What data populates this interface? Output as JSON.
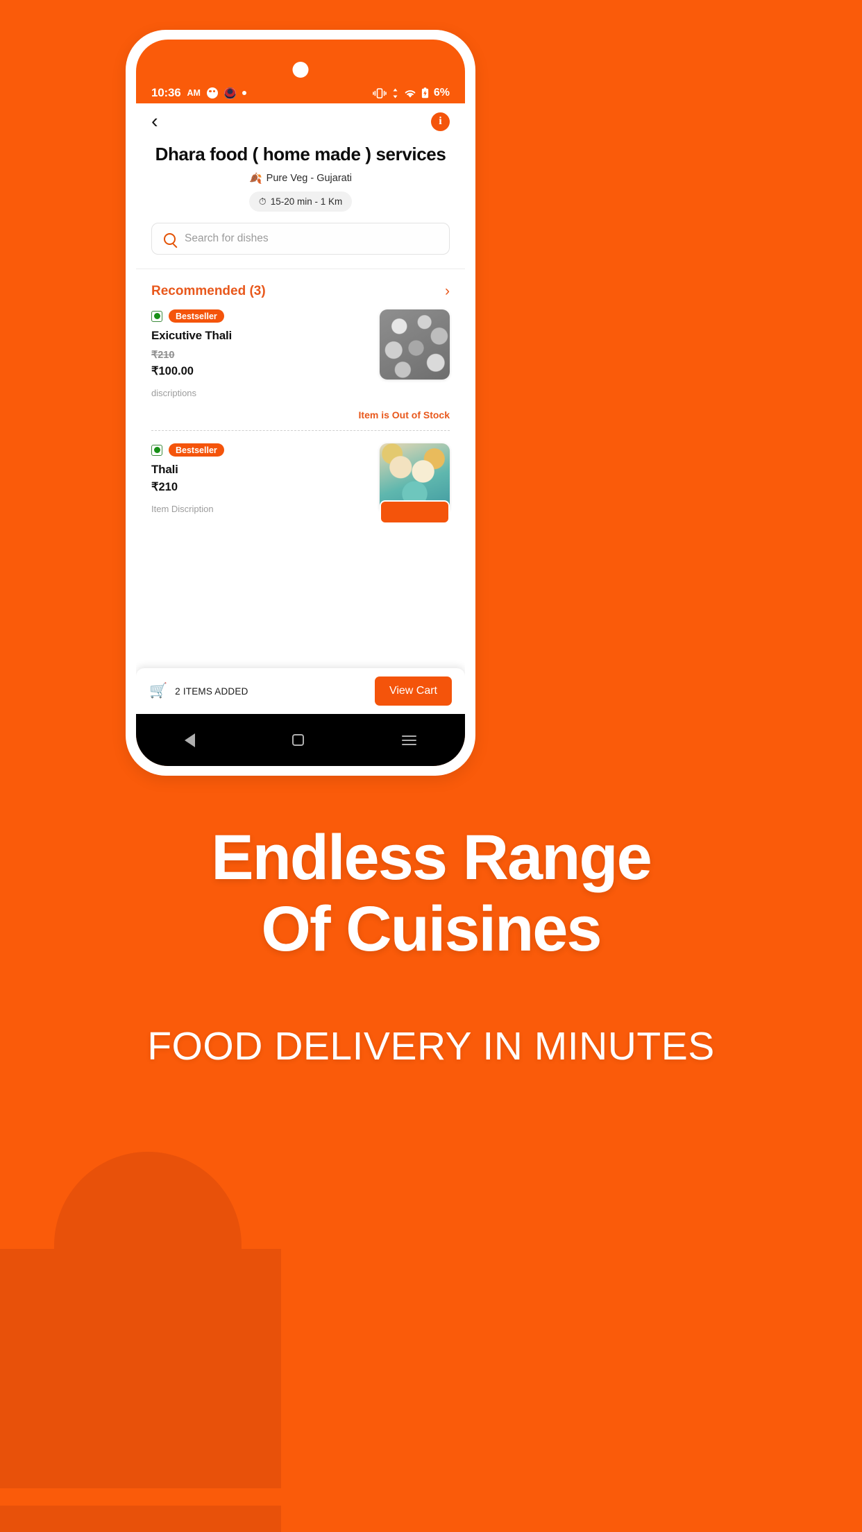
{
  "theme": {
    "brand_orange": "#FA5B0A",
    "accent_orange": "#F4540B",
    "deco_orange": "#E8510A",
    "veg_green": "#189018"
  },
  "status_bar": {
    "time": "10:36",
    "ampm": "AM",
    "app_badge_icon": "app-notification-icon",
    "avatar_badge_icon": "avatar-notification-icon",
    "dot_badge_icon": "dot-notification-icon",
    "vibrate_icon": "vibrate-icon",
    "data_icon": "data-transfer-icon",
    "wifi_icon": "wifi-icon",
    "battery_icon": "battery-charging-icon",
    "battery_level": "6%"
  },
  "topbar": {
    "back_icon": "back-chevron-icon",
    "info_icon": "info-icon",
    "info_label": "i"
  },
  "restaurant": {
    "name": "Dhara food ( home made ) services",
    "veg_label": "Pure Veg - Gujarati",
    "leaf_icon": "leaf-icon",
    "timer_icon": "stopwatch-icon",
    "delivery_info": "15-20 min - 1 Km"
  },
  "search": {
    "placeholder": "Search for dishes",
    "value": "",
    "icon": "search-icon"
  },
  "section": {
    "title": "Recommended (3)",
    "chevron_icon": "chevron-right-icon"
  },
  "menu_items": [
    {
      "veg_icon": "veg-mark-icon",
      "badge": "Bestseller",
      "name": "Exicutive Thali",
      "price_old": "₹210",
      "price_new": "₹100.00",
      "description": "discriptions",
      "thumb_name": "thali-photo-grayscale",
      "status": "Item is Out of Stock"
    },
    {
      "veg_icon": "veg-mark-icon",
      "badge": "Bestseller",
      "name": "Thali",
      "price_old": "",
      "price_new": "₹210",
      "description": "Item Discription",
      "thumb_name": "thali-photo-color",
      "status": ""
    }
  ],
  "cart_bar": {
    "cart_icon": "shopping-cart-icon",
    "items_label": "2 ITEMS ADDED",
    "view_cart_label": "View Cart"
  },
  "nav_bar": {
    "back_icon": "nav-back-icon",
    "home_icon": "nav-home-icon",
    "menu_icon": "nav-menu-icon"
  },
  "marketing": {
    "headline_line1": "Endless Range",
    "headline_line2": "Of Cuisines",
    "tagline": "FOOD DELIVERY IN MINUTES"
  }
}
